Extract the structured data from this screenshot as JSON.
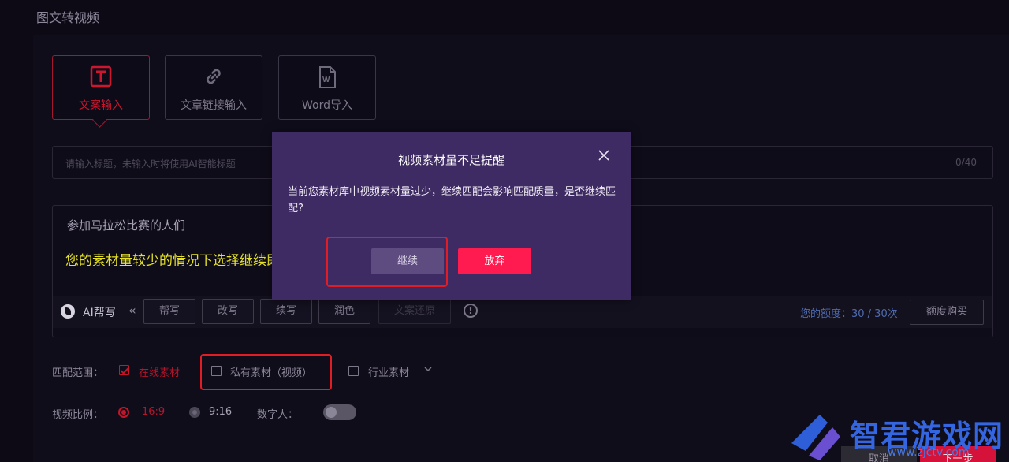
{
  "page_title": "图文转视频",
  "mode_tabs": [
    {
      "label": "文案输入",
      "icon": "text-t-icon",
      "active": true
    },
    {
      "label": "文章链接输入",
      "icon": "link-icon",
      "active": false
    },
    {
      "label": "Word导入",
      "icon": "word-doc-icon",
      "active": false
    }
  ],
  "title_input": {
    "placeholder": "请输入标题，未输入时将使用AI智能标题",
    "counter": "0/40"
  },
  "text_area": {
    "content": "参加马拉松比赛的人们"
  },
  "annotation": "您的素材量较少的情况下选择继续即可",
  "ai_toolbar": {
    "label": "AI帮写",
    "collapse_glyph": "«",
    "buttons": [
      "帮写",
      "改写",
      "续写",
      "润色"
    ],
    "restore_label": "文案还原",
    "quota_label": "您的额度：30 / 30次",
    "buy_label": "额度购买"
  },
  "match_scope": {
    "label": "匹配范围：",
    "options": [
      {
        "label": "在线素材",
        "checked": true
      },
      {
        "label": "私有素材（视频）",
        "checked": false
      },
      {
        "label": "行业素材",
        "checked": false
      }
    ]
  },
  "video_ratio": {
    "label": "视频比例：",
    "options": [
      {
        "label": "16:9",
        "selected": true
      },
      {
        "label": "9:16",
        "selected": false
      }
    ]
  },
  "digital_human": {
    "label": "数字人：",
    "enabled": false
  },
  "dialog": {
    "title": "视频素材量不足提醒",
    "message": "当前您素材库中视频素材量过少，继续匹配会影响匹配质量，是否继续匹配?",
    "continue_label": "继续",
    "abandon_label": "放弃"
  },
  "footer": {
    "cancel_label": "取消",
    "next_label": "下一步"
  },
  "watermark": {
    "text": "智君游戏网",
    "url": "www.zjctv.com"
  },
  "colors": {
    "accent": "#ff1a4f",
    "dialog_bg": "#3f2b63",
    "annotation": "#e6e22a",
    "highlight_box": "#e01c24"
  }
}
